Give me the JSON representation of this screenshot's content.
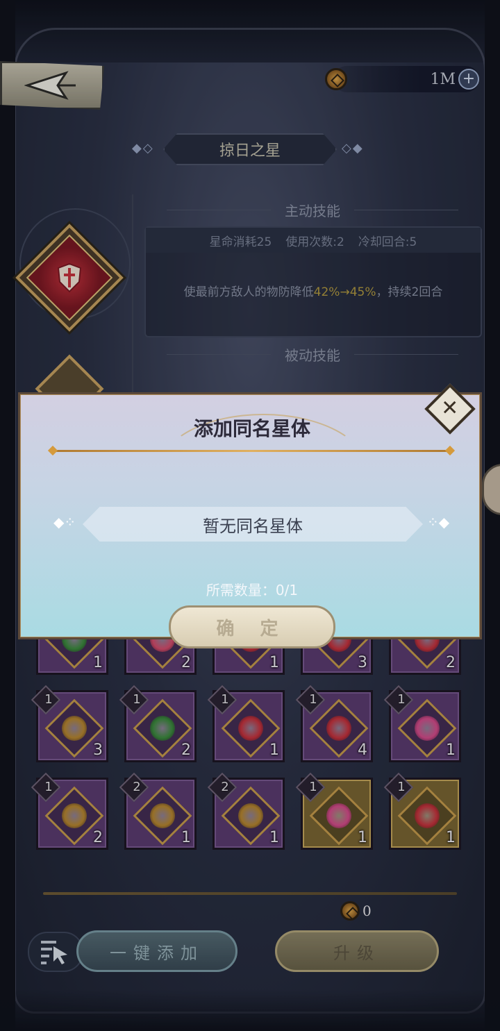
{
  "header": {
    "currency_value": "1M",
    "plus_label": "+",
    "title": "掠日之星"
  },
  "skills": {
    "active_heading": "主动技能",
    "stats": [
      "星命消耗25",
      "使用次数:2",
      "冷却回合:5"
    ],
    "desc_prefix": "使最前方敌人的物防降低",
    "desc_highlight": "42%→45%",
    "desc_suffix": "，持续2回合",
    "passive_heading": "被动技能"
  },
  "modal": {
    "title": "添加同名星体",
    "empty_text": "暂无同名星体",
    "required_text": "所需数量：0/1",
    "confirm_label": "确 定",
    "close_label": "✕"
  },
  "inventory": {
    "row1": [
      {
        "count": "1",
        "level": "",
        "color": "#3a8a3a",
        "frame": "purple"
      },
      {
        "count": "2",
        "level": "",
        "color": "#d84a6a",
        "frame": "purple"
      },
      {
        "count": "1",
        "level": "",
        "color": "#c8303a",
        "frame": "purple"
      },
      {
        "count": "3",
        "level": "",
        "color": "#c8303a",
        "frame": "purple"
      },
      {
        "count": "2",
        "level": "",
        "color": "#c8303a",
        "frame": "purple"
      }
    ],
    "row2": [
      {
        "count": "3",
        "level": "1",
        "color": "#b8862c",
        "frame": "purple"
      },
      {
        "count": "2",
        "level": "1",
        "color": "#3a8a3a",
        "frame": "purple"
      },
      {
        "count": "1",
        "level": "1",
        "color": "#c8303a",
        "frame": "purple"
      },
      {
        "count": "4",
        "level": "1",
        "color": "#c8303a",
        "frame": "purple"
      },
      {
        "count": "1",
        "level": "1",
        "color": "#d84a8a",
        "frame": "purple"
      }
    ],
    "row3": [
      {
        "count": "2",
        "level": "1",
        "color": "#b8862c",
        "frame": "purple"
      },
      {
        "count": "1",
        "level": "2",
        "color": "#b8862c",
        "frame": "purple"
      },
      {
        "count": "1",
        "level": "2",
        "color": "#b8862c",
        "frame": "purple"
      },
      {
        "count": "1",
        "level": "1",
        "color": "#d84a8a",
        "frame": "gold"
      },
      {
        "count": "1",
        "level": "1",
        "color": "#c8303a",
        "frame": "gold"
      }
    ]
  },
  "bottom": {
    "cost_value": "0",
    "auto_add_label": "一键添加",
    "upgrade_label": "升级"
  }
}
